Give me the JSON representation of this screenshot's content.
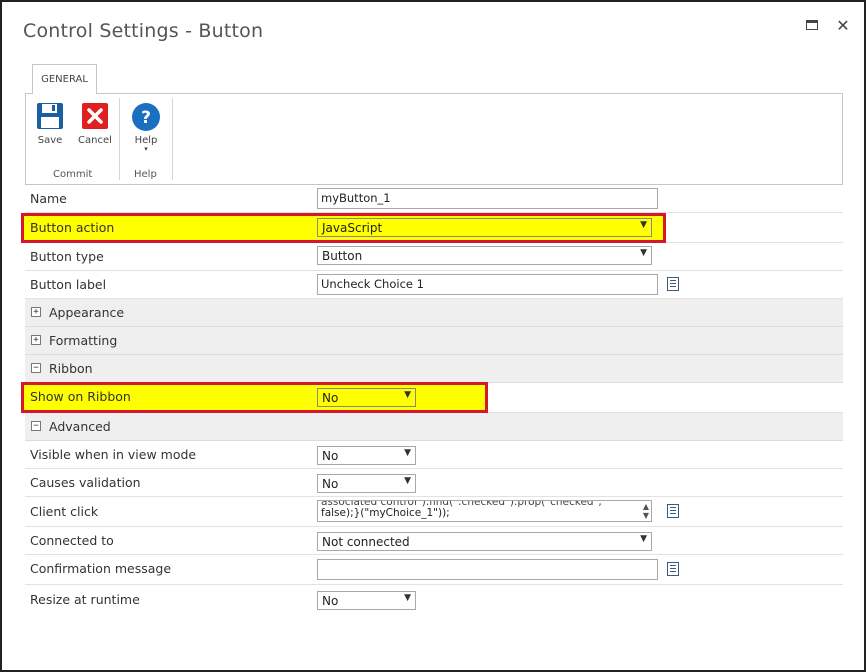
{
  "window": {
    "title": "Control Settings - Button",
    "maximize_icon": "maximize-icon",
    "close_icon": "close-icon",
    "close_glyph": "✕"
  },
  "ribbon": {
    "tab": "GENERAL",
    "groups": [
      {
        "label": "Commit",
        "buttons": [
          {
            "label": "Save",
            "icon": "save-icon"
          },
          {
            "label": "Cancel",
            "icon": "cancel-icon"
          }
        ]
      },
      {
        "label": "Help",
        "buttons": [
          {
            "label": "Help",
            "icon": "help-icon"
          }
        ]
      }
    ]
  },
  "fields": {
    "name": {
      "label": "Name",
      "value": "myButton_1"
    },
    "button_action": {
      "label": "Button action",
      "value": "JavaScript"
    },
    "button_type": {
      "label": "Button type",
      "value": "Button"
    },
    "button_label": {
      "label": "Button label",
      "value": "Uncheck Choice 1"
    },
    "appearance": {
      "label": "Appearance",
      "state": "+"
    },
    "formatting": {
      "label": "Formatting",
      "state": "+"
    },
    "ribbon_section": {
      "label": "Ribbon",
      "state": "−"
    },
    "show_on_ribbon": {
      "label": "Show on Ribbon",
      "value": "No"
    },
    "advanced": {
      "label": "Advanced",
      "state": "−"
    },
    "visible_view_mode": {
      "label": "Visible when in view mode",
      "value": "No"
    },
    "causes_validation": {
      "label": "Causes validation",
      "value": "No"
    },
    "client_click": {
      "label": "Client click",
      "line1": "associated control\").find(\":checked\").prop(\"checked\",",
      "line2": "false);}(\"myChoice_1\"));"
    },
    "connected_to": {
      "label": "Connected to",
      "value": "Not connected"
    },
    "confirmation_message": {
      "label": "Confirmation message",
      "value": ""
    },
    "resize_at_runtime": {
      "label": "Resize at runtime",
      "value": "No"
    }
  },
  "colors": {
    "highlight": "#ffff00",
    "highlight_border": "#d3182a",
    "save_icon": "#1a5fa0",
    "cancel_icon": "#e02020",
    "help_icon": "#1a6fc0"
  }
}
